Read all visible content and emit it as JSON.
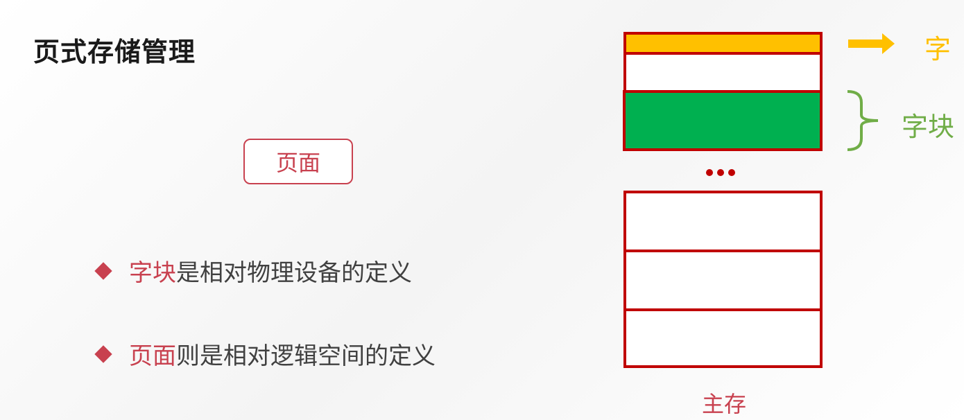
{
  "title": "页式存储管理",
  "page_box": "页面",
  "bullets": [
    {
      "highlight": "字块",
      "rest": "是相对物理设备的定义"
    },
    {
      "highlight": "页面",
      "rest": "则是相对逻辑空间的定义"
    }
  ],
  "diagram": {
    "word_label": "字",
    "block_label": "字块",
    "ellipsis": "...",
    "memory_label": "主存",
    "colors": {
      "border": "#c00000",
      "word": "#ffc000",
      "block": "#00b050",
      "block_label": "#70ad47",
      "accent": "#c8414f"
    }
  }
}
